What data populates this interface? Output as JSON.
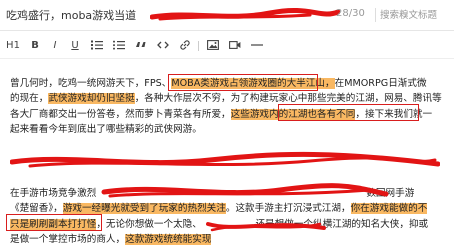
{
  "header": {
    "title": "吃鸡盛行，moba游戏当道",
    "counter": "28/30",
    "search_placeholder": "搜索糗文标题"
  },
  "toolbar": {
    "h1": "H1",
    "bold": "B",
    "italic": "I",
    "underline": "U"
  },
  "paragraph1": {
    "line1_a": "曾几何时，吃鸡一统网游天下，FPS、",
    "line1_hl": "MOBA类游戏占领游戏圈的大半江山，",
    "line1_b": "在MMORPG日渐式微",
    "line2_a": "的现在，",
    "line2_hl": "武侠游戏却仍旧坚挺",
    "line2_b": "，各种大作层次不穷，为了构建玩家心中那些完美的江湖，网易、腾讯等",
    "line3": "各大厂商都交出一份答卷，然而萝卜青菜各有所爱，",
    "line3_hl": "这些游戏内的江湖也各有不同",
    "line3_b": "，接下来我们就一",
    "line4": "起来看看今年到底出了哪些精彩的武侠网游。"
  },
  "paragraph2": {
    "line1_a": "在手游市场竞争激烈",
    "line1_b": "数回网手游",
    "line2_a": "《楚留香》，",
    "line2_hl": "游戏一经曝光就受到了玩家的热烈关注",
    "line2_b": "。这款手游主打沉浸式江湖，",
    "line2_hl2": "你在游戏能做的不",
    "line3_hl": "只是刷刷副本打打怪",
    "line3_b": "，无论你想做一个太隐、",
    "line3_c": "，还是想做一个纵横江湖的知名大侠，抑或",
    "line4_a": "是做一个掌控市场的商人，",
    "line4_hl": "这款游戏统统能实现"
  }
}
